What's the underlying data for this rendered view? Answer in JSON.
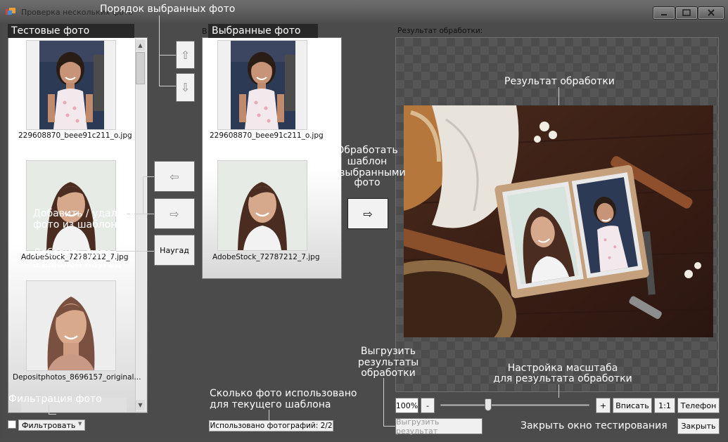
{
  "window": {
    "title": "Проверка нескольких фото"
  },
  "test_photos": {
    "header": "Тестовые фото",
    "items": [
      {
        "caption": "229608870_beee91c211_o.jpg"
      },
      {
        "caption": "AdobeStock_72787212_7.jpg"
      },
      {
        "caption": "Depositphotos_8696157_original..."
      }
    ]
  },
  "selected_photos": {
    "caption_partial": "В",
    "header": "Выбранные фото",
    "items": [
      {
        "caption": "229608870_beee91c211_o.jpg"
      },
      {
        "caption": "AdobeStock_72787212_7.jpg"
      }
    ]
  },
  "buttons": {
    "move_up": "⇧",
    "move_down": "⇩",
    "remove": "⇦",
    "add": "⇨",
    "random": "Наугад",
    "process": "⇨",
    "export": "Выгрузить результат",
    "close": "Закрыть"
  },
  "filter": {
    "label": "Фильтровать",
    "checked": false
  },
  "used_count": "Использовано фотографий: 2/2",
  "result": {
    "label": "Результат обработки:"
  },
  "zoom": {
    "value": "100%",
    "minus": "-",
    "plus": "+",
    "fit": "Вписать",
    "one_to_one": "1:1",
    "phone": "Телефон",
    "level": 0.31
  },
  "annotations": {
    "order": "Порядок выбранных фото",
    "add_remove_1": "Добавить / удалить",
    "add_remove_2": "фото из шаблона",
    "random_1": "Добавить фото",
    "random_2": "в шаблон наугад",
    "process_1": "Обработать",
    "process_2": "шаблон",
    "process_3": "с выбранными",
    "process_4": "фото",
    "result": "Результат обработки",
    "export_1": "Выгрузить",
    "export_2": "результаты",
    "export_3": "обработки",
    "zoom_1": "Настройка масштаба",
    "zoom_2": "для результата обработки",
    "count_1": "Сколько фото использовано",
    "count_2": "для текущего шаблона",
    "filter": "Фильтрация фото",
    "close": "Закрыть окно тестирования"
  }
}
